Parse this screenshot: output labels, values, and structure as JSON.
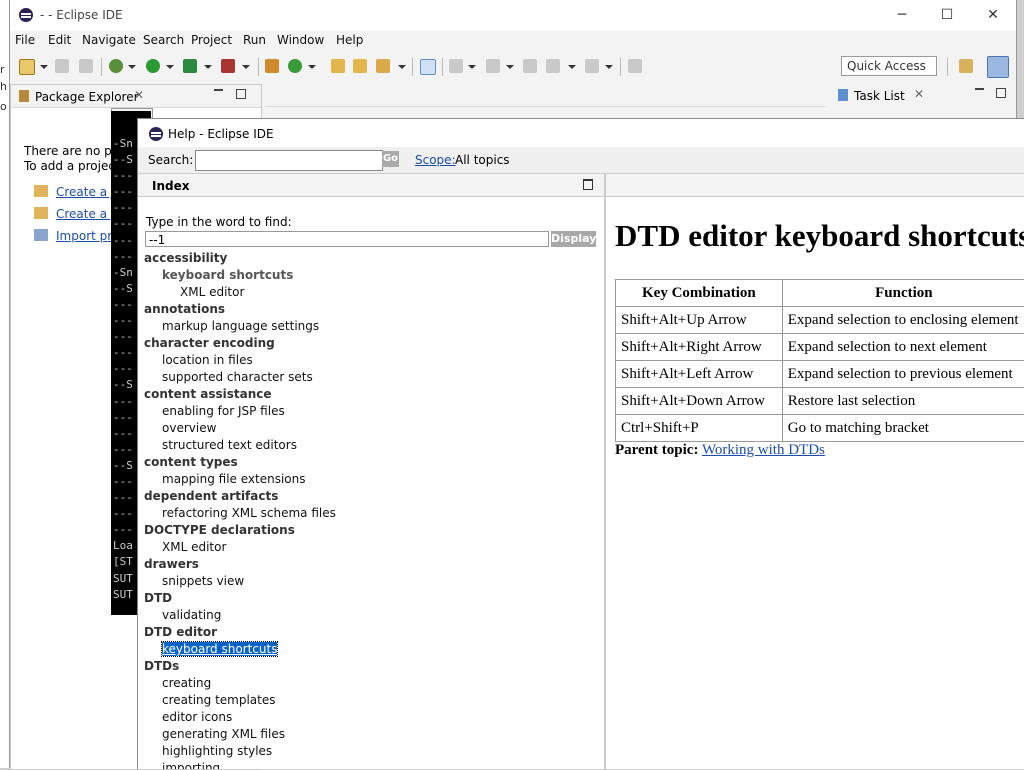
{
  "window": {
    "title": "- - Eclipse IDE",
    "minimize": "─",
    "maximize": "☐",
    "close": "✕"
  },
  "menu": [
    "File",
    "Edit",
    "Navigate",
    "Search",
    "Project",
    "Run",
    "Window",
    "Help"
  ],
  "quick_access": "Quick Access",
  "package_explorer": {
    "tab_label": "Package Explorer",
    "message_line1": "There are no proj",
    "message_line2": "To add a project:",
    "links": [
      "Create a Ja",
      "Create a pr",
      "Import pro"
    ]
  },
  "task_list": {
    "tab_label": "Task List"
  },
  "console": {
    "lines": [
      "-Sn",
      "--S",
      "---",
      "---",
      "---",
      "---",
      "---",
      "---",
      "-Sn",
      "--S",
      "---",
      "---",
      "---",
      "---",
      "---",
      "--S",
      "---",
      "---",
      "---",
      "---",
      "--S",
      "---",
      "---",
      "---",
      "---",
      "Loa",
      "[ST",
      "SUT",
      "SUT"
    ]
  },
  "help": {
    "title": "Help - Eclipse IDE",
    "search_label": "Search:",
    "search_value": "",
    "go_label": "Go",
    "scope_label": "Scope:",
    "scope_value": "All topics",
    "index": {
      "title": "Index",
      "prompt": "Type in the word to find:",
      "input_value": "--1",
      "display_label": "Display",
      "entries": [
        {
          "text": "accessibility",
          "level": 0
        },
        {
          "text": "keyboard shortcuts",
          "level": 1,
          "bold": true
        },
        {
          "text": "XML editor",
          "level": 2
        },
        {
          "text": "annotations",
          "level": 0
        },
        {
          "text": "markup language settings",
          "level": 1
        },
        {
          "text": "character encoding",
          "level": 0
        },
        {
          "text": "location in files",
          "level": 1
        },
        {
          "text": "supported character sets",
          "level": 1
        },
        {
          "text": "content assistance",
          "level": 0
        },
        {
          "text": "enabling for JSP files",
          "level": 1
        },
        {
          "text": "overview",
          "level": 1
        },
        {
          "text": "structured text editors",
          "level": 1
        },
        {
          "text": "content types",
          "level": 0
        },
        {
          "text": "mapping file extensions",
          "level": 1
        },
        {
          "text": "dependent artifacts",
          "level": 0
        },
        {
          "text": "refactoring XML schema files",
          "level": 1
        },
        {
          "text": "DOCTYPE declarations",
          "level": 0
        },
        {
          "text": "XML editor",
          "level": 1
        },
        {
          "text": "drawers",
          "level": 0
        },
        {
          "text": "snippets view",
          "level": 1
        },
        {
          "text": "DTD",
          "level": 0
        },
        {
          "text": "validating",
          "level": 1
        },
        {
          "text": "DTD editor",
          "level": 0
        },
        {
          "text": "keyboard shortcuts",
          "level": 1,
          "selected": true
        },
        {
          "text": "DTDs",
          "level": 0
        },
        {
          "text": "creating",
          "level": 1
        },
        {
          "text": "creating templates",
          "level": 1
        },
        {
          "text": "editor icons",
          "level": 1
        },
        {
          "text": "generating XML files",
          "level": 1
        },
        {
          "text": "highlighting styles",
          "level": 1
        },
        {
          "text": "importing",
          "level": 1
        }
      ]
    },
    "topic": {
      "heading": "DTD editor keyboard shortcuts",
      "columns": [
        "Key Combination",
        "Function"
      ],
      "rows": [
        [
          "Shift+Alt+Up Arrow",
          "Expand selection to enclosing element"
        ],
        [
          "Shift+Alt+Right Arrow",
          "Expand selection to next element"
        ],
        [
          "Shift+Alt+Left Arrow",
          "Expand selection to previous element"
        ],
        [
          "Shift+Alt+Down Arrow",
          "Restore last selection"
        ],
        [
          "Ctrl+Shift+P",
          "Go to matching bracket"
        ]
      ],
      "parent_label": "Parent topic:",
      "parent_link": "Working with DTDs"
    }
  }
}
